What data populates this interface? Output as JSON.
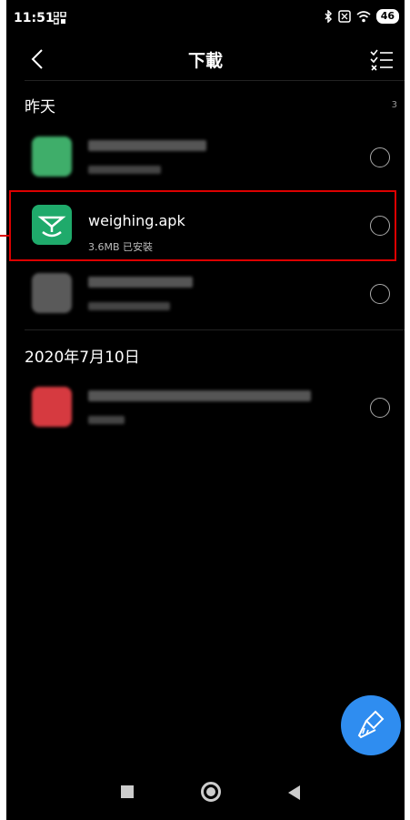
{
  "status_bar": {
    "time": "11:51",
    "battery": "46",
    "icons": [
      "grid-icon",
      "bluetooth-icon",
      "sim-icon",
      "wifi-icon",
      "battery-icon"
    ]
  },
  "header": {
    "title": "下載"
  },
  "sections": [
    {
      "heading": "昨天",
      "count": "3",
      "items": [
        {
          "name": "",
          "meta": "",
          "icon_color": "#3fae6a",
          "blurred": true
        },
        {
          "name": "weighing.apk",
          "meta": "3.6MB  已安裝",
          "icon_color": "#1faa6b",
          "blurred": false,
          "highlighted": true
        },
        {
          "name": "",
          "meta": "",
          "icon_color": "#5a5a5a",
          "blurred": true
        }
      ]
    },
    {
      "heading": "2020年7月10日",
      "items": [
        {
          "name": "",
          "meta": "",
          "icon_color": "#d63a40",
          "blurred": true
        }
      ]
    }
  ],
  "fab": {
    "icon": "broom-icon",
    "color": "#2f8df0"
  },
  "nav": {
    "icons": [
      "recents-square-icon",
      "home-circle-icon",
      "back-triangle-icon"
    ]
  },
  "colors": {
    "highlight": "#dd0000",
    "background": "#000000"
  }
}
